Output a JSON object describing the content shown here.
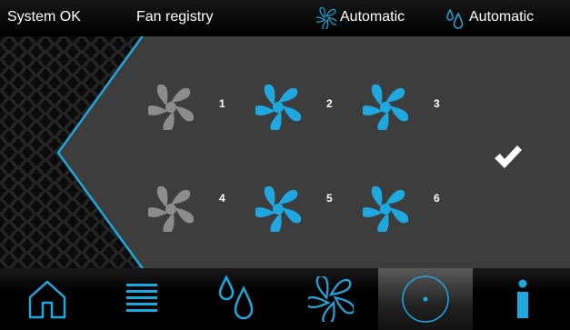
{
  "status_bar": {
    "system_status": "System OK",
    "screen_title": "Fan registry",
    "fan_mode": "Automatic",
    "humidity_mode": "Automatic"
  },
  "fans": [
    {
      "number": "1",
      "active": false
    },
    {
      "number": "2",
      "active": true
    },
    {
      "number": "3",
      "active": true
    },
    {
      "number": "4",
      "active": false
    },
    {
      "number": "5",
      "active": true
    },
    {
      "number": "6",
      "active": true
    }
  ],
  "colors": {
    "accent": "#1fa8e0",
    "inactive": "#8c8c8c",
    "panel": "#3d3d3d"
  },
  "nav": {
    "items": [
      {
        "icon": "home-icon",
        "active": false
      },
      {
        "icon": "menu-list-icon",
        "active": false
      },
      {
        "icon": "water-drops-icon",
        "active": false
      },
      {
        "icon": "fan-icon",
        "active": false
      },
      {
        "icon": "circle-dot-icon",
        "active": true
      },
      {
        "icon": "info-icon",
        "active": false
      }
    ]
  }
}
